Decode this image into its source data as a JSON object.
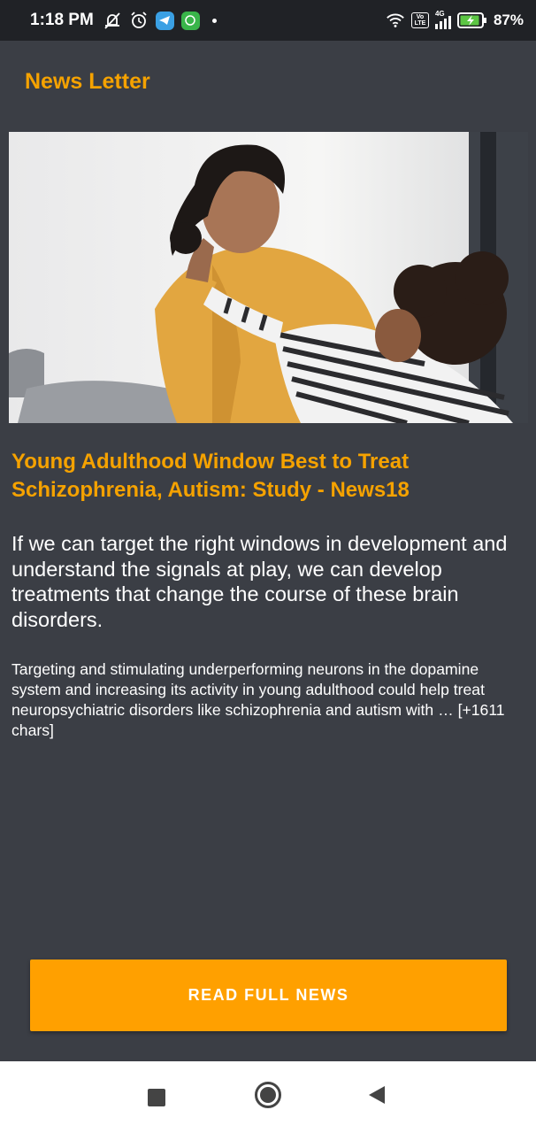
{
  "status_bar": {
    "time": "1:18 PM",
    "battery": "87%",
    "left_icons": [
      "mute-icon",
      "alarm-icon",
      "telegram-icon",
      "whatsapp-icon",
      "dot"
    ],
    "right_icons": [
      "wifi-icon",
      "volte-icon",
      "signal-icon",
      "battery-icon"
    ],
    "network": "4G"
  },
  "app_bar": {
    "title": "News Letter"
  },
  "article": {
    "title": "Young Adulthood Window Best to Treat Schizophrenia, Autism: Study - News18",
    "description": "If we can target the right windows in development and understand the signals at play, we can develop treatments that change the course of these brain disorders.",
    "content": "Targeting and stimulating underperforming neurons in the dopamine system and increasing its activity in young adulthood could help treat neuropsychiatric disorders like schizophrenia and autism with … [+1611 chars]"
  },
  "button": {
    "label": "READ FULL NEWS"
  },
  "nav": {
    "items": [
      "recents-icon",
      "home-icon",
      "back-icon"
    ]
  },
  "colors": {
    "accent": "#f5a200",
    "button": "#ffa000",
    "background": "#3b3e45",
    "status_bar": "#202226"
  }
}
